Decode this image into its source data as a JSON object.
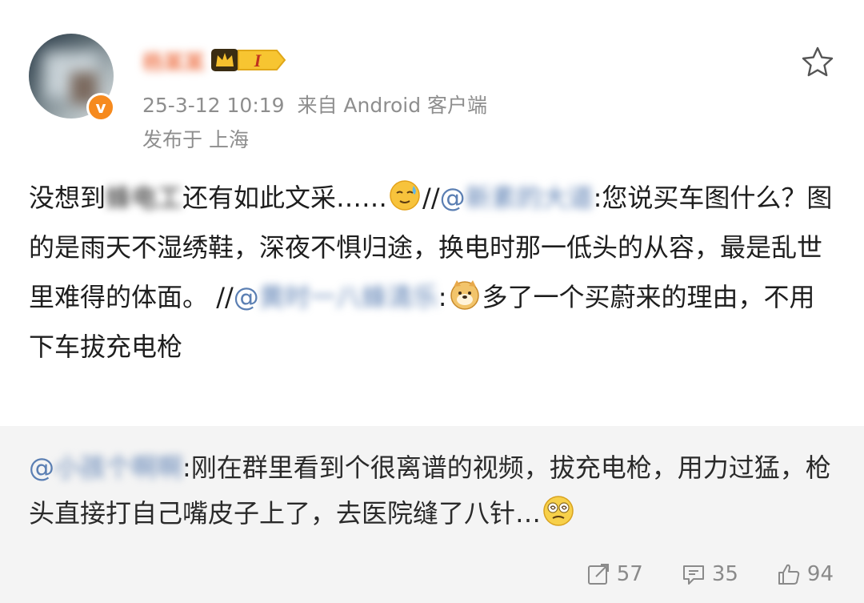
{
  "post_header": {
    "username": "杨某某",
    "vip_level": "I",
    "timestamp": "25-3-12 10:19",
    "source": "来自 Android 客户端",
    "location": "发布于 上海",
    "verified_badge": "v"
  },
  "post_body": {
    "part1": "没想到",
    "blur1": "蜂电工",
    "part2": "还有如此文采……",
    "emoji1": "sweat-smile-emoji",
    "sep1": "//",
    "at1": "@",
    "blur2": "新素的大道",
    "part3": ":您说买车图什么？图的是雨天不湿绣鞋，深夜不惧归途，换电时那一低头的从容，最是乱世里难得的体面。",
    "sep2": "//",
    "at2": "@",
    "blur3": "黄时一八蜂清乐",
    "part4": ":",
    "emoji2": "doge-emoji",
    "part5": "多了一个买蔚来的理由，不用下车拔充电枪"
  },
  "repost": {
    "at": "@",
    "blur": "小孩个啊啊",
    "text": ":刚在群里看到个很离谱的视频，拔充电枪，用力过猛，枪头直接打自己嘴皮子上了，去医院缝了八针…",
    "emoji": "dizzy-face-emoji",
    "actions": {
      "repost_count": "57",
      "comment_count": "35",
      "like_count": "94"
    }
  },
  "colors": {
    "mention": "#5b7fb3",
    "username": "#f0815a",
    "meta": "#8e8e8e",
    "repost_bg": "#f4f4f4",
    "badge_orange": "#f68a1e"
  }
}
